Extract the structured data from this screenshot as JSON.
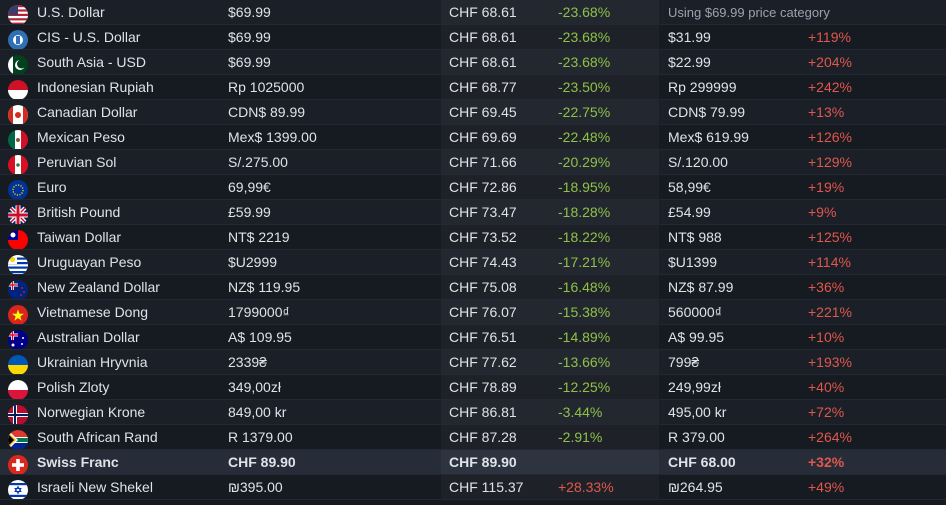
{
  "colors": {
    "negative": "#8ec14a",
    "positive": "#e0574c",
    "background": "#161a21"
  },
  "rows": [
    {
      "flag": "us-flag-icon",
      "currency": "U.S. Dollar",
      "price": "$69.99",
      "chf": "CHF 68.61",
      "chf_diff": "-23.68%",
      "recommended": "Using $69.99 price category",
      "rec_diff": ""
    },
    {
      "flag": "cis-flag-icon",
      "currency": "CIS - U.S. Dollar",
      "price": "$69.99",
      "chf": "CHF 68.61",
      "chf_diff": "-23.68%",
      "recommended": "$31.99",
      "rec_diff": "+119%"
    },
    {
      "flag": "south-asia-flag-icon",
      "currency": "South Asia - USD",
      "price": "$69.99",
      "chf": "CHF 68.61",
      "chf_diff": "-23.68%",
      "recommended": "$22.99",
      "rec_diff": "+204%"
    },
    {
      "flag": "indonesia-flag-icon",
      "currency": "Indonesian Rupiah",
      "price": "Rp 1025000",
      "chf": "CHF 68.77",
      "chf_diff": "-23.50%",
      "recommended": "Rp 299999",
      "rec_diff": "+242%"
    },
    {
      "flag": "canada-flag-icon",
      "currency": "Canadian Dollar",
      "price": "CDN$ 89.99",
      "chf": "CHF 69.45",
      "chf_diff": "-22.75%",
      "recommended": "CDN$ 79.99",
      "rec_diff": "+13%"
    },
    {
      "flag": "mexico-flag-icon",
      "currency": "Mexican Peso",
      "price": "Mex$ 1399.00",
      "chf": "CHF 69.69",
      "chf_diff": "-22.48%",
      "recommended": "Mex$ 619.99",
      "rec_diff": "+126%"
    },
    {
      "flag": "peru-flag-icon",
      "currency": "Peruvian Sol",
      "price": "S/.275.00",
      "chf": "CHF 71.66",
      "chf_diff": "-20.29%",
      "recommended": "S/.120.00",
      "rec_diff": "+129%"
    },
    {
      "flag": "eu-flag-icon",
      "currency": "Euro",
      "price": "69,99€",
      "chf": "CHF 72.86",
      "chf_diff": "-18.95%",
      "recommended": "58,99€",
      "rec_diff": "+19%"
    },
    {
      "flag": "uk-flag-icon",
      "currency": "British Pound",
      "price": "£59.99",
      "chf": "CHF 73.47",
      "chf_diff": "-18.28%",
      "recommended": "£54.99",
      "rec_diff": "+9%"
    },
    {
      "flag": "taiwan-flag-icon",
      "currency": "Taiwan Dollar",
      "price": "NT$ 2219",
      "chf": "CHF 73.52",
      "chf_diff": "-18.22%",
      "recommended": "NT$ 988",
      "rec_diff": "+125%"
    },
    {
      "flag": "uruguay-flag-icon",
      "currency": "Uruguayan Peso",
      "price": "$U2999",
      "chf": "CHF 74.43",
      "chf_diff": "-17.21%",
      "recommended": "$U1399",
      "rec_diff": "+114%"
    },
    {
      "flag": "new-zealand-flag-icon",
      "currency": "New Zealand Dollar",
      "price": "NZ$ 119.95",
      "chf": "CHF 75.08",
      "chf_diff": "-16.48%",
      "recommended": "NZ$ 87.99",
      "rec_diff": "+36%"
    },
    {
      "flag": "vietnam-flag-icon",
      "currency": "Vietnamese Dong",
      "price": "1799000₫",
      "chf": "CHF 76.07",
      "chf_diff": "-15.38%",
      "recommended": "560000₫",
      "rec_diff": "+221%"
    },
    {
      "flag": "australia-flag-icon",
      "currency": "Australian Dollar",
      "price": "A$ 109.95",
      "chf": "CHF 76.51",
      "chf_diff": "-14.89%",
      "recommended": "A$ 99.95",
      "rec_diff": "+10%"
    },
    {
      "flag": "ukraine-flag-icon",
      "currency": "Ukrainian Hryvnia",
      "price": "2339₴",
      "chf": "CHF 77.62",
      "chf_diff": "-13.66%",
      "recommended": "799₴",
      "rec_diff": "+193%"
    },
    {
      "flag": "poland-flag-icon",
      "currency": "Polish Zloty",
      "price": "349,00zł",
      "chf": "CHF 78.89",
      "chf_diff": "-12.25%",
      "recommended": "249,99zł",
      "rec_diff": "+40%"
    },
    {
      "flag": "norway-flag-icon",
      "currency": "Norwegian Krone",
      "price": "849,00 kr",
      "chf": "CHF 86.81",
      "chf_diff": "-3.44%",
      "recommended": "495,00 kr",
      "rec_diff": "+72%"
    },
    {
      "flag": "south-africa-flag-icon",
      "currency": "South African Rand",
      "price": "R 1379.00",
      "chf": "CHF 87.28",
      "chf_diff": "-2.91%",
      "recommended": "R 379.00",
      "rec_diff": "+264%"
    },
    {
      "flag": "switzerland-flag-icon",
      "currency": "Swiss Franc",
      "price": "CHF 89.90",
      "chf": "CHF 89.90",
      "chf_diff": "",
      "recommended": "CHF 68.00",
      "rec_diff": "+32%",
      "highlight": true
    },
    {
      "flag": "israel-flag-icon",
      "currency": "Israeli New Shekel",
      "price": "₪395.00",
      "chf": "CHF 115.37",
      "chf_diff": "+28.33%",
      "recommended": "₪264.95",
      "rec_diff": "+49%"
    }
  ]
}
